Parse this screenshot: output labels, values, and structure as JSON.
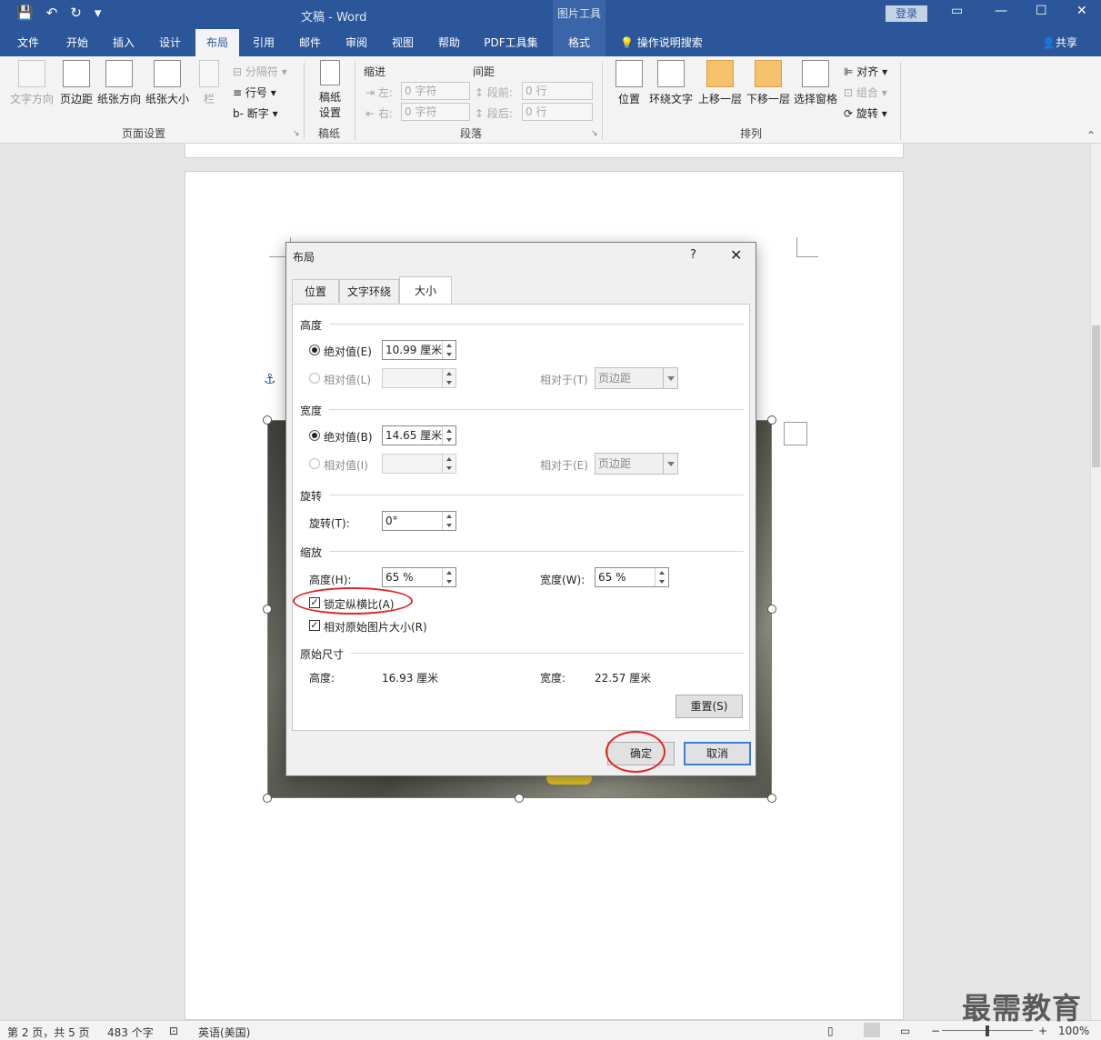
{
  "titlebar": {
    "doc_title": "文稿  -  Word",
    "context_tools": "图片工具",
    "login": "登录"
  },
  "tabs": [
    "文件",
    "开始",
    "插入",
    "设计",
    "布局",
    "引用",
    "邮件",
    "审阅",
    "视图",
    "帮助",
    "PDF工具集",
    "格式"
  ],
  "active_tab": "布局",
  "search_hint": "操作说明搜索",
  "share": "共享",
  "ribbon": {
    "page_setup": {
      "label": "页面设置",
      "text_direction": "文字方向",
      "margins": "页边距",
      "orientation": "纸张方向",
      "size": "纸张大小",
      "columns": "栏",
      "breaks": "分隔符",
      "line_numbers": "行号",
      "hyphenation": "断字"
    },
    "manuscript": {
      "label": "稿纸",
      "btn_line1": "稿纸",
      "btn_line2": "设置"
    },
    "paragraph": {
      "label": "段落",
      "indent": "缩进",
      "spacing": "间距",
      "left": "左:",
      "right": "右:",
      "before": "段前:",
      "after": "段后:",
      "left_val": "0 字符",
      "right_val": "0 字符",
      "before_val": "0 行",
      "after_val": "0 行"
    },
    "arrange": {
      "label": "排列",
      "position": "位置",
      "wrap": "环绕文字",
      "forward": "上移一层",
      "backward": "下移一层",
      "pane": "选择窗格",
      "align": "对齐",
      "group": "组合",
      "rotate": "旋转"
    }
  },
  "dialog": {
    "title": "布局",
    "help": "?",
    "tabs": [
      "位置",
      "文字环绕",
      "大小"
    ],
    "height": {
      "title": "高度",
      "absolute": "绝对值(E)",
      "absolute_val": "10.99 厘米",
      "relative": "相对值(L)",
      "relative_to": "相对于(T)",
      "relative_to_val": "页边距"
    },
    "width": {
      "title": "宽度",
      "absolute": "绝对值(B)",
      "absolute_val": "14.65 厘米",
      "relative": "相对值(I)",
      "relative_to": "相对于(E)",
      "relative_to_val": "页边距"
    },
    "rotate": {
      "title": "旋转",
      "label": "旋转(T):",
      "value": "0°"
    },
    "scale": {
      "title": "缩放",
      "height_label": "高度(H):",
      "height_val": "65 %",
      "width_label": "宽度(W):",
      "width_val": "65 %",
      "lock_aspect": "锁定纵横比(A)",
      "relative_original": "相对原始图片大小(R)"
    },
    "original": {
      "title": "原始尺寸",
      "height_label": "高度:",
      "height_val": "16.93 厘米",
      "width_label": "宽度:",
      "width_val": "22.57 厘米"
    },
    "reset": "重置(S)",
    "ok": "确定",
    "cancel": "取消"
  },
  "status": {
    "page": "第 2 页，共 5 页",
    "words": "483 个字",
    "language": "英语(美国)",
    "zoom": "100%"
  },
  "watermark": "最需教育",
  "colors": {
    "titlebar": "#2b579a",
    "annotation": "#e0262a"
  }
}
